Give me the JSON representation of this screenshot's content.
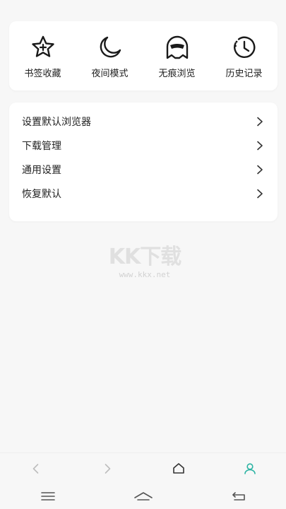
{
  "quick_actions": [
    {
      "label": "书签收藏",
      "icon": "star-plus-icon"
    },
    {
      "label": "夜间模式",
      "icon": "moon-icon"
    },
    {
      "label": "无痕浏览",
      "icon": "ghost-icon"
    },
    {
      "label": "历史记录",
      "icon": "clock-icon"
    }
  ],
  "settings": [
    {
      "label": "设置默认浏览器"
    },
    {
      "label": "下载管理"
    },
    {
      "label": "通用设置"
    },
    {
      "label": "恢复默认"
    }
  ],
  "watermark": {
    "logo": "KK下载",
    "url": "www.kkx.net"
  },
  "browser_bar": [
    "back-icon",
    "forward-icon",
    "home-icon",
    "user-icon"
  ],
  "colors": {
    "background": "#f7f7f7",
    "card": "#ffffff",
    "accent": "#2bb3a3",
    "icon_dark": "#1a1a1a",
    "icon_muted": "#bdbdbd"
  }
}
